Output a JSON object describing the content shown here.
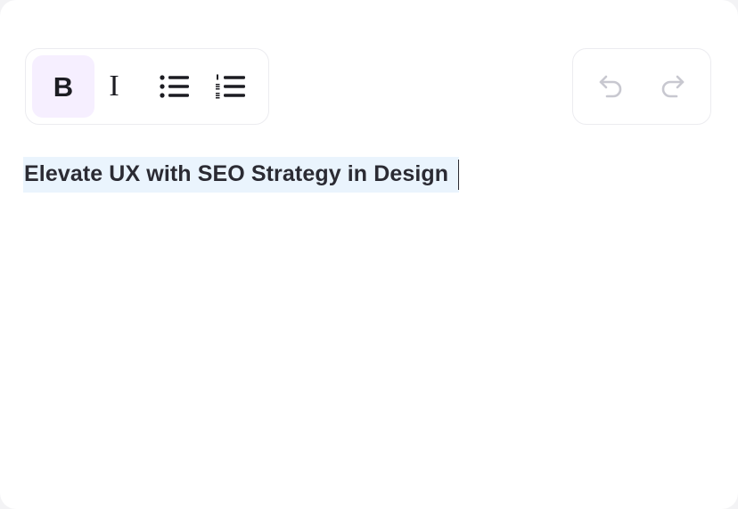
{
  "toolbar": {
    "bold_label": "B",
    "italic_label": "I",
    "bullet_list_icon": "bullet-list-icon",
    "numbered_list_icon": "numbered-list-icon",
    "undo_icon": "undo-icon",
    "redo_icon": "redo-icon"
  },
  "editor": {
    "text": "Elevate UX with SEO Strategy in Design"
  },
  "colors": {
    "active_button_bg": "#f6efff",
    "selection_bg": "#eaf4fd",
    "text": "#2b2b33",
    "disabled_icon": "#c8c8d0"
  }
}
